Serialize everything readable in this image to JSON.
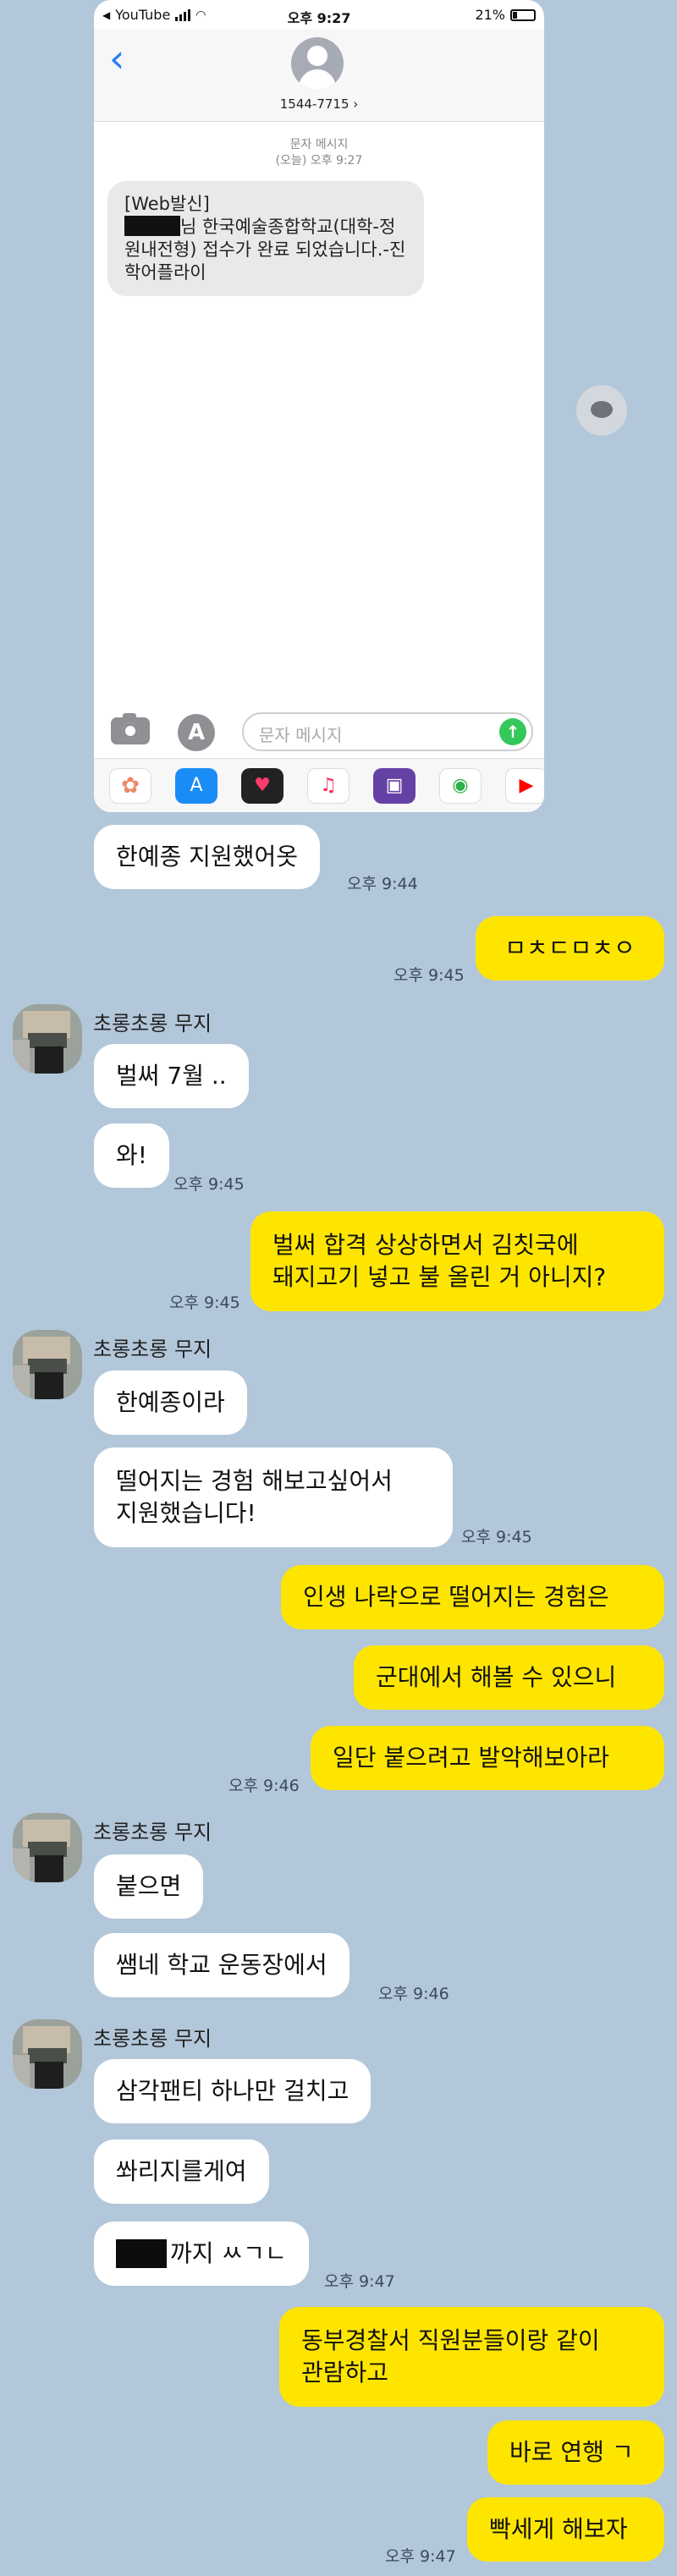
{
  "ios": {
    "status": {
      "app": "YouTube",
      "time": "오후 9:27",
      "battery": "21%"
    },
    "contact_number": "1544-7715 ›",
    "system_label": "문자 메시지",
    "system_time": "(오늘) 오후 9:27",
    "message": {
      "line1": "[Web발신]",
      "after_redact": "님 한국예술종합학교(대학-정원내전형) 접수가 완료 되었습니다.-진학어플라이"
    },
    "input_placeholder": "문자 메시지",
    "tray_icons": [
      "photos-icon",
      "appstore-icon",
      "heart-app-icon",
      "music-icon",
      "twitch-icon",
      "find-icon",
      "youtube-icon"
    ]
  },
  "chat": {
    "other_name": "초롱초롱 무지",
    "messages": {
      "m1": "한예종 지원했어옷",
      "m1_time": "오후 9:44",
      "m2": "ㅁㅊㄷㅁㅊㅇ",
      "m2_time": "오후 9:45",
      "m3": "벌써 7월 ..",
      "m4": "와!",
      "m4_time": "오후 9:45",
      "m5_l1": "벌써 합격 상상하면서 김칫국에",
      "m5_l2": "돼지고기 넣고 불 올린 거 아니지?",
      "m5_time": "오후 9:45",
      "m6": "한예종이라",
      "m7_l1": "떨어지는 경험 해보고싶어서",
      "m7_l2": "지원했습니다!",
      "m7_time": "오후 9:45",
      "m8": "인생 나락으로 떨어지는 경험은",
      "m9": "군대에서 해볼 수 있으니",
      "m10": "일단 붙으려고 발악해보아라",
      "m10_time": "오후 9:46",
      "m11": "붙으면",
      "m12": "쌤네 학교 운동장에서",
      "m12_time": "오후 9:46",
      "m13": "삼각팬티 하나만 걸치고",
      "m14": "쏴리지를게여",
      "m15_suffix": "까지 ㅆㄱㄴ",
      "m15_time": "오후 9:47",
      "m16_l1": "동부경찰서 직원분들이랑 같이",
      "m16_l2": "관람하고",
      "m17": "바로 연행 ㄱ",
      "m18": "빡세게 해보자",
      "m18_time": "오후 9:47"
    }
  },
  "colors": {
    "background": "#b2c7d9",
    "my_bubble": "#fee500",
    "other_bubble": "#ffffff",
    "ios_link": "#2b7cf6",
    "send": "#34c759"
  }
}
